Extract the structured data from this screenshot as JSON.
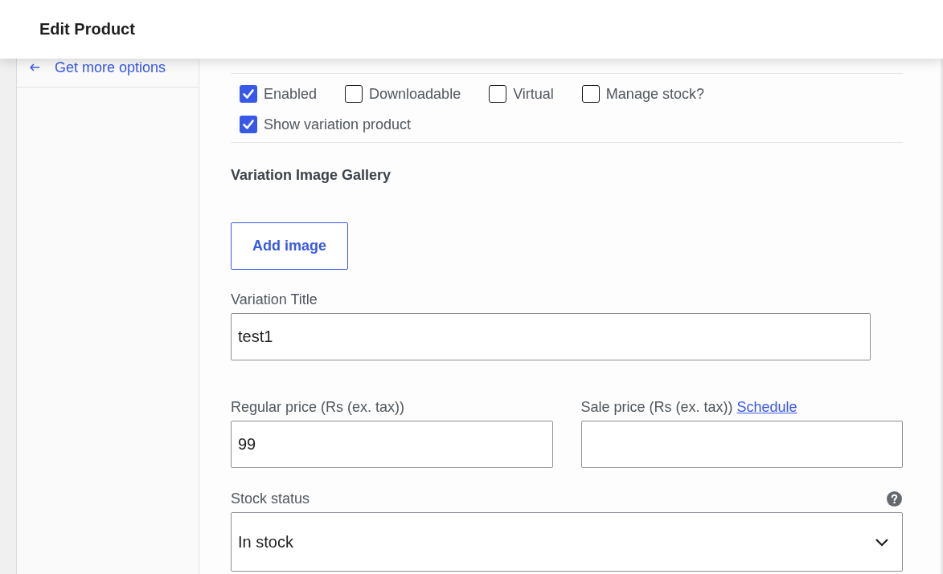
{
  "header": {
    "title": "Edit Product"
  },
  "sidebar": {
    "items": [
      {
        "label": "Get more options"
      }
    ]
  },
  "variation": {
    "options": [
      {
        "label": "Enabled",
        "checked": true
      },
      {
        "label": "Downloadable",
        "checked": false
      },
      {
        "label": "Virtual",
        "checked": false
      },
      {
        "label": "Manage stock?",
        "checked": false
      },
      {
        "label": "Show variation product",
        "checked": true
      }
    ],
    "gallery": {
      "heading": "Variation Image Gallery",
      "button": "Add image"
    },
    "title_field": {
      "label": "Variation Title",
      "value": "test1"
    },
    "prices": [
      {
        "label": "Regular price (Rs (ex. tax))",
        "value": "99"
      },
      {
        "label": "Sale price (Rs (ex. tax))",
        "link": "Schedule"
      }
    ],
    "stock_status": {
      "label": "Stock status",
      "value": "In stock"
    }
  }
}
